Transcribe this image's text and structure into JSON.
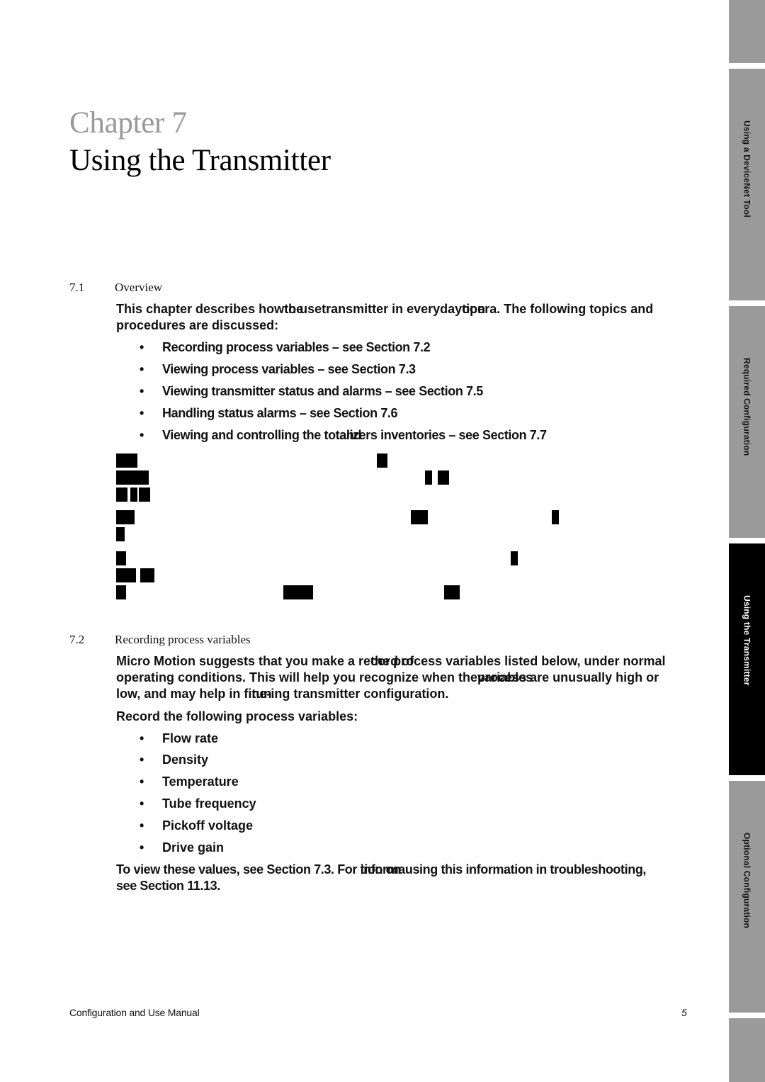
{
  "chapter": {
    "label": "Chapter 7",
    "title": "Using the Transmitter"
  },
  "sections": [
    {
      "number": "7.1",
      "title": "Overview",
      "intro": {
        "part1": "This chapter describes how",
        "overlap_a": "to use",
        "overlap_b": "the",
        "part2": "transmitter in everyday",
        "overlap_c": "opera",
        "overlap_d": "tion",
        "part3": ". The following topics and",
        "line2": "procedures are discussed:"
      },
      "bullets": [
        {
          "text": "Recording process variables – see Section 7.2"
        },
        {
          "text": "Viewing process variables – see Section 7.3"
        },
        {
          "text": "Viewing transmitter status and alarms – see Section 7.5"
        },
        {
          "text": "Handling status alarms – see Section 7.6"
        },
        {
          "pre": "Viewing and controlling the tot",
          "overlap_a": "alizers",
          "overlap_b": "and",
          "post": " inventories – see Section 7.7"
        }
      ],
      "garbled_glyphs": "█"
    },
    {
      "number": "7.2",
      "title": "Recording process variables",
      "para1": {
        "l1_pre": "Micro Motion suggests that you make a re",
        "l1_ov_a": "cord of",
        "l1_ov_b": "the pro",
        "l1_post": "cess variables listed below, under normal",
        "l2_pre": "operating conditions. This will help you recognize when the",
        "l2_ov_a": "process",
        "l2_ov_b": "variables",
        "l2_post": " are unusually high or",
        "l3_pre": "low, and may help in fi",
        "l3_ov_a": "ne-",
        "l3_ov_b": "tun",
        "l3_post": "ing transmitter configuration."
      },
      "record_intro": "Record the following process variables:",
      "variables": [
        "Flow rate",
        "Density",
        "Temperature",
        "Tube frequency",
        "Pickoff voltage",
        "Drive gain"
      ],
      "closing": {
        "l1_pre": "To view these values, see Section 7.3. For ",
        "l1_ov_a": "informa",
        "l1_ov_b": "tion on",
        "l1_post": "using this information in troubleshooting,",
        "l2": "see Section 11.13."
      }
    }
  ],
  "bullet_char": "•",
  "footer": {
    "manual": "Configuration and Use Manual",
    "page": "5"
  },
  "side_tabs": [
    {
      "label": "",
      "active": false
    },
    {
      "label": "Using a DeviceNet Tool",
      "active": false
    },
    {
      "label": "Required Configuration",
      "active": false
    },
    {
      "label": "Using the Transmitter",
      "active": true
    },
    {
      "label": "Optional Configuration",
      "active": false
    },
    {
      "label": "",
      "active": false
    }
  ],
  "colors": {
    "chapter_label": "#999999",
    "tab_inactive": "#9a9a9a",
    "tab_active": "#000000"
  }
}
